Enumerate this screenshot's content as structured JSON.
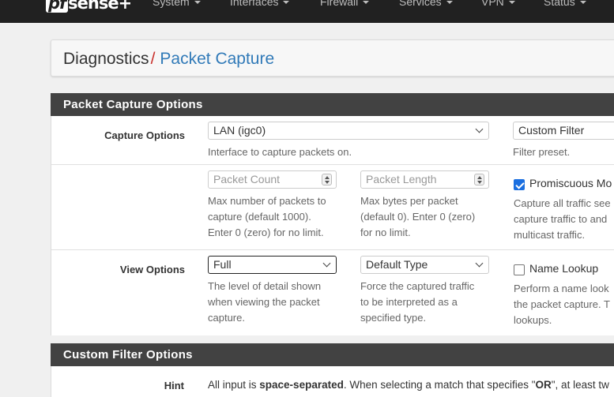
{
  "navbar": {
    "logo_pf": "pf",
    "logo_sense": "sense",
    "logo_plus": "+",
    "items": [
      {
        "label": "System"
      },
      {
        "label": "Interfaces"
      },
      {
        "label": "Firewall"
      },
      {
        "label": "Services"
      },
      {
        "label": "VPN"
      },
      {
        "label": "Status"
      }
    ]
  },
  "breadcrumb": {
    "root": "Diagnostics",
    "separator": "/",
    "current": "Packet Capture"
  },
  "capture_panel": {
    "title": "Packet Capture Options",
    "capture_options": {
      "label": "Capture Options",
      "interface_value": "LAN (igc0)",
      "interface_help": "Interface to capture packets on.",
      "filter_value": "Custom Filter",
      "filter_help": "Filter preset."
    },
    "limits": {
      "packet_count_placeholder": "Packet Count",
      "packet_count_help": [
        "Max number of packets to",
        "capture (default 1000).",
        "Enter 0 (zero) for no limit."
      ],
      "packet_length_placeholder": "Packet Length",
      "packet_length_help": [
        "Max bytes per packet",
        "(default 0). Enter 0 (zero)",
        "for no limit."
      ],
      "promiscuous_label": "Promiscuous Mo",
      "promiscuous_checked": true,
      "promiscuous_help": [
        "Capture all traffic see",
        "capture traffic to and",
        "multicast traffic."
      ]
    },
    "view_options": {
      "label": "View Options",
      "detail_value": "Full",
      "detail_help": [
        "The level of detail shown",
        "when viewing the packet",
        "capture."
      ],
      "type_value": "Default Type",
      "type_help": [
        "Force the captured traffic",
        "to be interpreted as a",
        "specified type."
      ],
      "name_lookup_label": "Name Lookup",
      "name_lookup_checked": false,
      "name_lookup_help": [
        "Perform a name look",
        "the packet capture. T",
        "lookups."
      ]
    }
  },
  "filter_panel": {
    "title": "Custom Filter Options",
    "hint_label": "Hint",
    "hint_1": "All input is ",
    "hint_bold_1": "space-separated",
    "hint_2": ". When selecting a match that specifies \"",
    "hint_bold_2": "OR",
    "hint_3": "\", at least tw"
  },
  "colors": {
    "navbar": "#212121",
    "panel_heading": "#424242",
    "link_blue": "#317ab8",
    "separator_red": "#c9302c",
    "checkbox_blue": "#1a6fe0"
  }
}
